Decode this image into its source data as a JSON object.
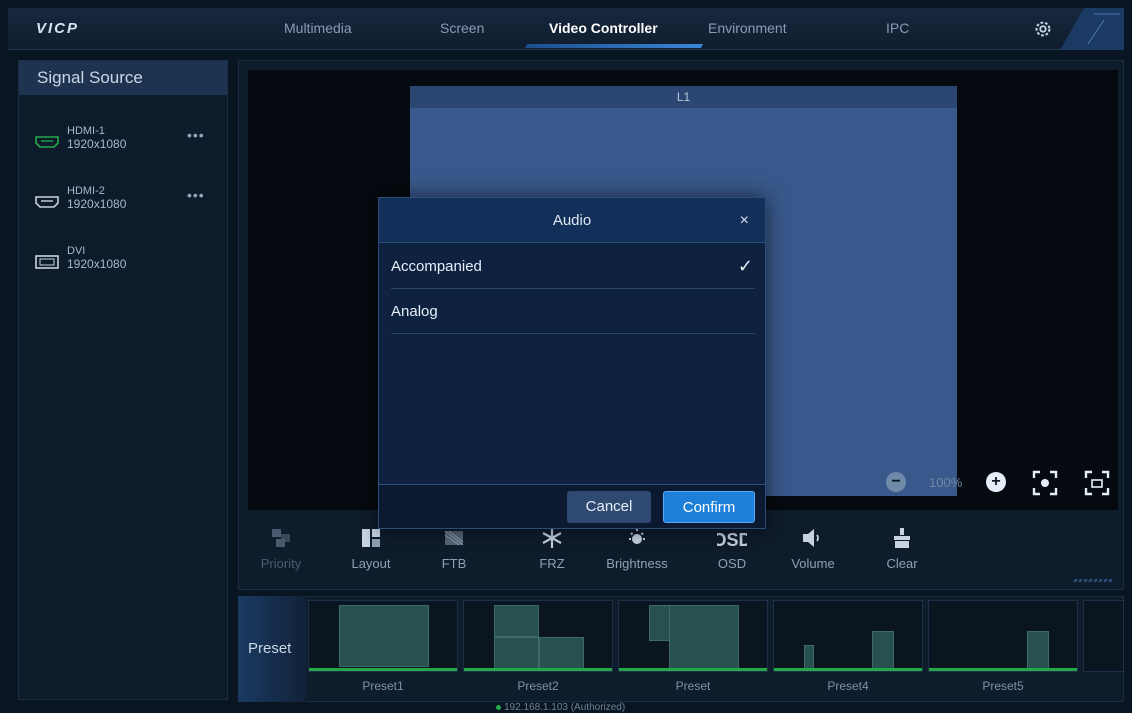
{
  "app": {
    "logo": "VICP"
  },
  "nav": {
    "tabs": [
      {
        "label": "Multimedia"
      },
      {
        "label": "Screen"
      },
      {
        "label": "Video Controller"
      },
      {
        "label": "Environment"
      },
      {
        "label": "IPC"
      }
    ],
    "active_tab": "Video Controller"
  },
  "sidebar": {
    "title": "Signal Source",
    "sources": [
      {
        "name": "HDMI-1",
        "resolution": "1920x1080",
        "icon": "hdmi-icon",
        "color": "#23a84a",
        "more": "•••"
      },
      {
        "name": "HDMI-2",
        "resolution": "1920x1080",
        "icon": "hdmi-icon",
        "color": "#c7d3e2",
        "more": "•••"
      },
      {
        "name": "DVI",
        "resolution": "1920x1080",
        "icon": "dvi-icon",
        "color": "#c7d3e2"
      }
    ]
  },
  "canvas": {
    "layer_label": "L1",
    "zoom": "100%"
  },
  "toolbar": {
    "items": [
      {
        "label": "Priority",
        "icon": "priority-icon",
        "enabled": false
      },
      {
        "label": "Layout",
        "icon": "layout-icon",
        "enabled": true
      },
      {
        "label": "FTB",
        "icon": "ftb-icon",
        "enabled": true
      },
      {
        "label": "FRZ",
        "icon": "freeze-icon",
        "enabled": true
      },
      {
        "label": "Brightness",
        "icon": "brightness-icon",
        "enabled": true
      },
      {
        "label": "OSD",
        "icon": "osd-icon",
        "enabled": true
      },
      {
        "label": "Volume",
        "icon": "volume-icon",
        "enabled": true
      },
      {
        "label": "Clear",
        "icon": "clear-icon",
        "enabled": true
      }
    ]
  },
  "presets": {
    "label": "Preset",
    "items": [
      {
        "name": "Preset1"
      },
      {
        "name": "Preset2"
      },
      {
        "name": "Preset"
      },
      {
        "name": "Preset4"
      },
      {
        "name": "Preset5"
      }
    ]
  },
  "status": {
    "text": "192.168.1.103 (Authorized)"
  },
  "dialog": {
    "title": "Audio",
    "close": "×",
    "options": [
      {
        "label": "Accompanied",
        "selected": true
      },
      {
        "label": "Analog",
        "selected": false
      }
    ],
    "check": "✓",
    "cancel": "Cancel",
    "confirm": "Confirm"
  },
  "colors": {
    "accent": "#1e7fd8",
    "preset_active": "#23a84a",
    "layer": "#39598c"
  }
}
